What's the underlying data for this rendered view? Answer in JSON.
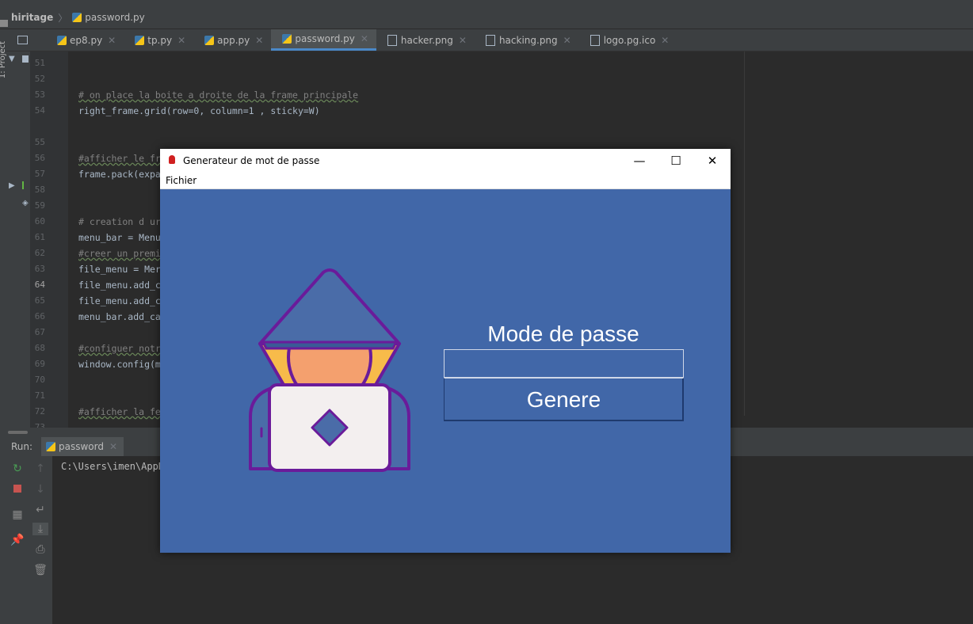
{
  "breadcrumb": {
    "project": "hiritage",
    "file": "password.py"
  },
  "tool_windows": {
    "project_label": "1: Project"
  },
  "tabs": [
    {
      "label": "ep8.py",
      "icon": "python-file-icon",
      "active": false
    },
    {
      "label": "tp.py",
      "icon": "python-file-icon",
      "active": false
    },
    {
      "label": "app.py",
      "icon": "python-file-icon",
      "active": false
    },
    {
      "label": "password.py",
      "icon": "python-file-icon",
      "active": true
    },
    {
      "label": "hacker.png",
      "icon": "image-file-icon",
      "active": false
    },
    {
      "label": "hacking.png",
      "icon": "image-file-icon",
      "active": false
    },
    {
      "label": "logo.pg.ico",
      "icon": "image-file-icon",
      "active": false
    }
  ],
  "editor": {
    "current_line": "64",
    "lines": [
      {
        "n": "51",
        "text": ""
      },
      {
        "n": "52",
        "text": ""
      },
      {
        "n": "53",
        "text": "# on place la boite a droite de la frame principale"
      },
      {
        "n": "54",
        "text": "right_frame.grid(row=0, column=1 , sticky=W)"
      },
      {
        "n": "55",
        "text": ""
      },
      {
        "n": "56",
        "text": ""
      },
      {
        "n": "57",
        "text": "#afficher le fr"
      },
      {
        "n": "58",
        "text": "frame.pack(expa"
      },
      {
        "n": "59",
        "text": ""
      },
      {
        "n": "60",
        "text": ""
      },
      {
        "n": "61",
        "text": "# creation d ur"
      },
      {
        "n": "62",
        "text": "menu_bar = Menu"
      },
      {
        "n": "63",
        "text": "#creer un premi"
      },
      {
        "n": "64",
        "text": "file_menu = Mer"
      },
      {
        "n": "65",
        "text": "file_menu.add_c"
      },
      {
        "n": "66",
        "text": "file_menu.add_c"
      },
      {
        "n": "67",
        "text": "menu_bar.add_ca"
      },
      {
        "n": "68",
        "text": ""
      },
      {
        "n": "69",
        "text": "#configuer notr"
      },
      {
        "n": "70",
        "text": "window.config(m"
      },
      {
        "n": "71",
        "text": ""
      },
      {
        "n": "72",
        "text": ""
      },
      {
        "n": "73",
        "text": "#afficher la fe"
      }
    ]
  },
  "run_panel": {
    "label": "Run:",
    "tab": "password",
    "output": "C:\\Users\\imen\\AppD"
  },
  "tk_window": {
    "title": "Generateur de mot de passe",
    "menu": "Fichier",
    "heading": "Mode de passe",
    "entry_value": "",
    "button_label": "Genere",
    "background": "#4167a8"
  }
}
